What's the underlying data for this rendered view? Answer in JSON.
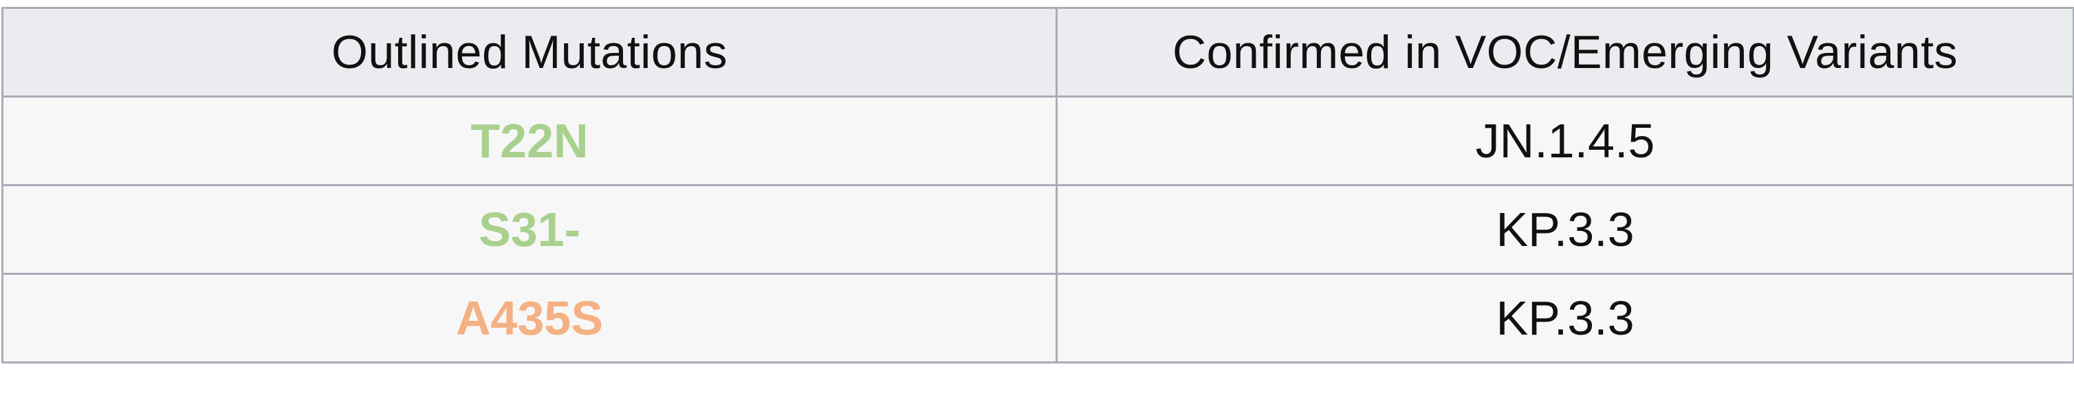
{
  "table": {
    "headers": [
      "Outlined Mutations",
      "Confirmed in VOC/Emerging Variants"
    ],
    "rows": [
      {
        "mutation": "T22N",
        "variant": "JN.1.4.5",
        "color": "#a9d18e"
      },
      {
        "mutation": "S31-",
        "variant": "KP.3.3",
        "color": "#a9d18e"
      },
      {
        "mutation": "A435S",
        "variant": "KP.3.3",
        "color": "#f4b183"
      }
    ]
  }
}
